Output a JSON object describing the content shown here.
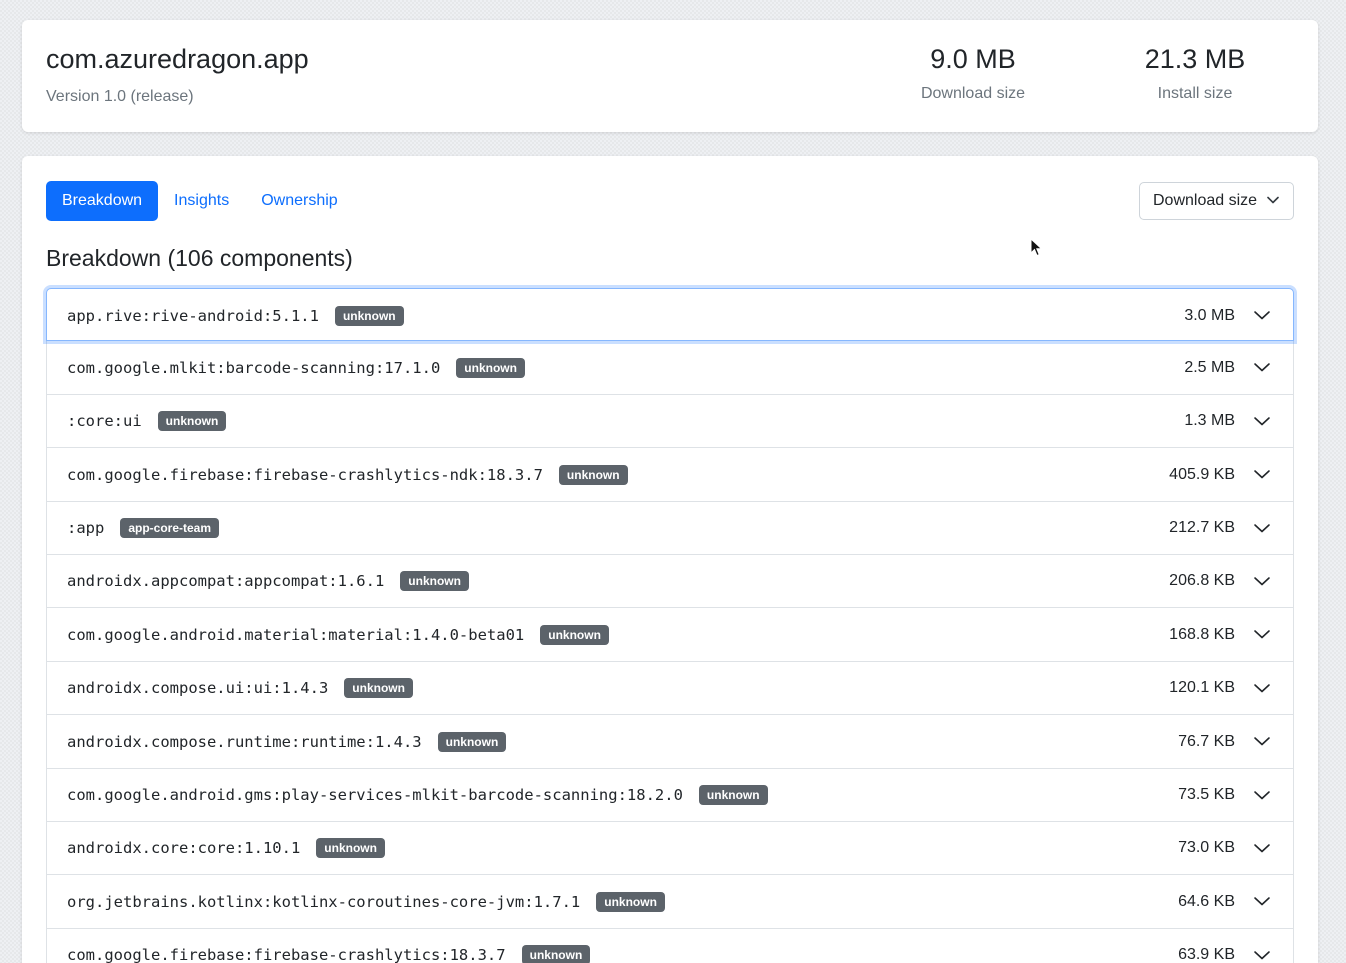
{
  "header": {
    "title": "com.azuredragon.app",
    "version": "Version 1.0 (release)",
    "download_size": {
      "value": "9.0 MB",
      "label": "Download size"
    },
    "install_size": {
      "value": "21.3 MB",
      "label": "Install size"
    }
  },
  "tabs": [
    {
      "label": "Breakdown",
      "active": true
    },
    {
      "label": "Insights",
      "active": false
    },
    {
      "label": "Ownership",
      "active": false
    }
  ],
  "size_select": {
    "value": "Download size",
    "icon": "chevron-down-icon"
  },
  "section_title": "Breakdown (106 components)",
  "components": [
    {
      "name": "app.rive:rive-android:5.1.1",
      "owner": "unknown",
      "size": "3.0 MB"
    },
    {
      "name": "com.google.mlkit:barcode-scanning:17.1.0",
      "owner": "unknown",
      "size": "2.5 MB"
    },
    {
      "name": ":core:ui",
      "owner": "unknown",
      "size": "1.3 MB"
    },
    {
      "name": "com.google.firebase:firebase-crashlytics-ndk:18.3.7",
      "owner": "unknown",
      "size": "405.9 KB"
    },
    {
      "name": ":app",
      "owner": "app-core-team",
      "size": "212.7 KB"
    },
    {
      "name": "androidx.appcompat:appcompat:1.6.1",
      "owner": "unknown",
      "size": "206.8 KB"
    },
    {
      "name": "com.google.android.material:material:1.4.0-beta01",
      "owner": "unknown",
      "size": "168.8 KB"
    },
    {
      "name": "androidx.compose.ui:ui:1.4.3",
      "owner": "unknown",
      "size": "120.1 KB"
    },
    {
      "name": "androidx.compose.runtime:runtime:1.4.3",
      "owner": "unknown",
      "size": "76.7 KB"
    },
    {
      "name": "com.google.android.gms:play-services-mlkit-barcode-scanning:18.2.0",
      "owner": "unknown",
      "size": "73.5 KB"
    },
    {
      "name": "androidx.core:core:1.10.1",
      "owner": "unknown",
      "size": "73.0 KB"
    },
    {
      "name": "org.jetbrains.kotlinx:kotlinx-coroutines-core-jvm:1.7.1",
      "owner": "unknown",
      "size": "64.6 KB"
    },
    {
      "name": "com.google.firebase:firebase-crashlytics:18.3.7",
      "owner": "unknown",
      "size": "63.9 KB"
    }
  ]
}
